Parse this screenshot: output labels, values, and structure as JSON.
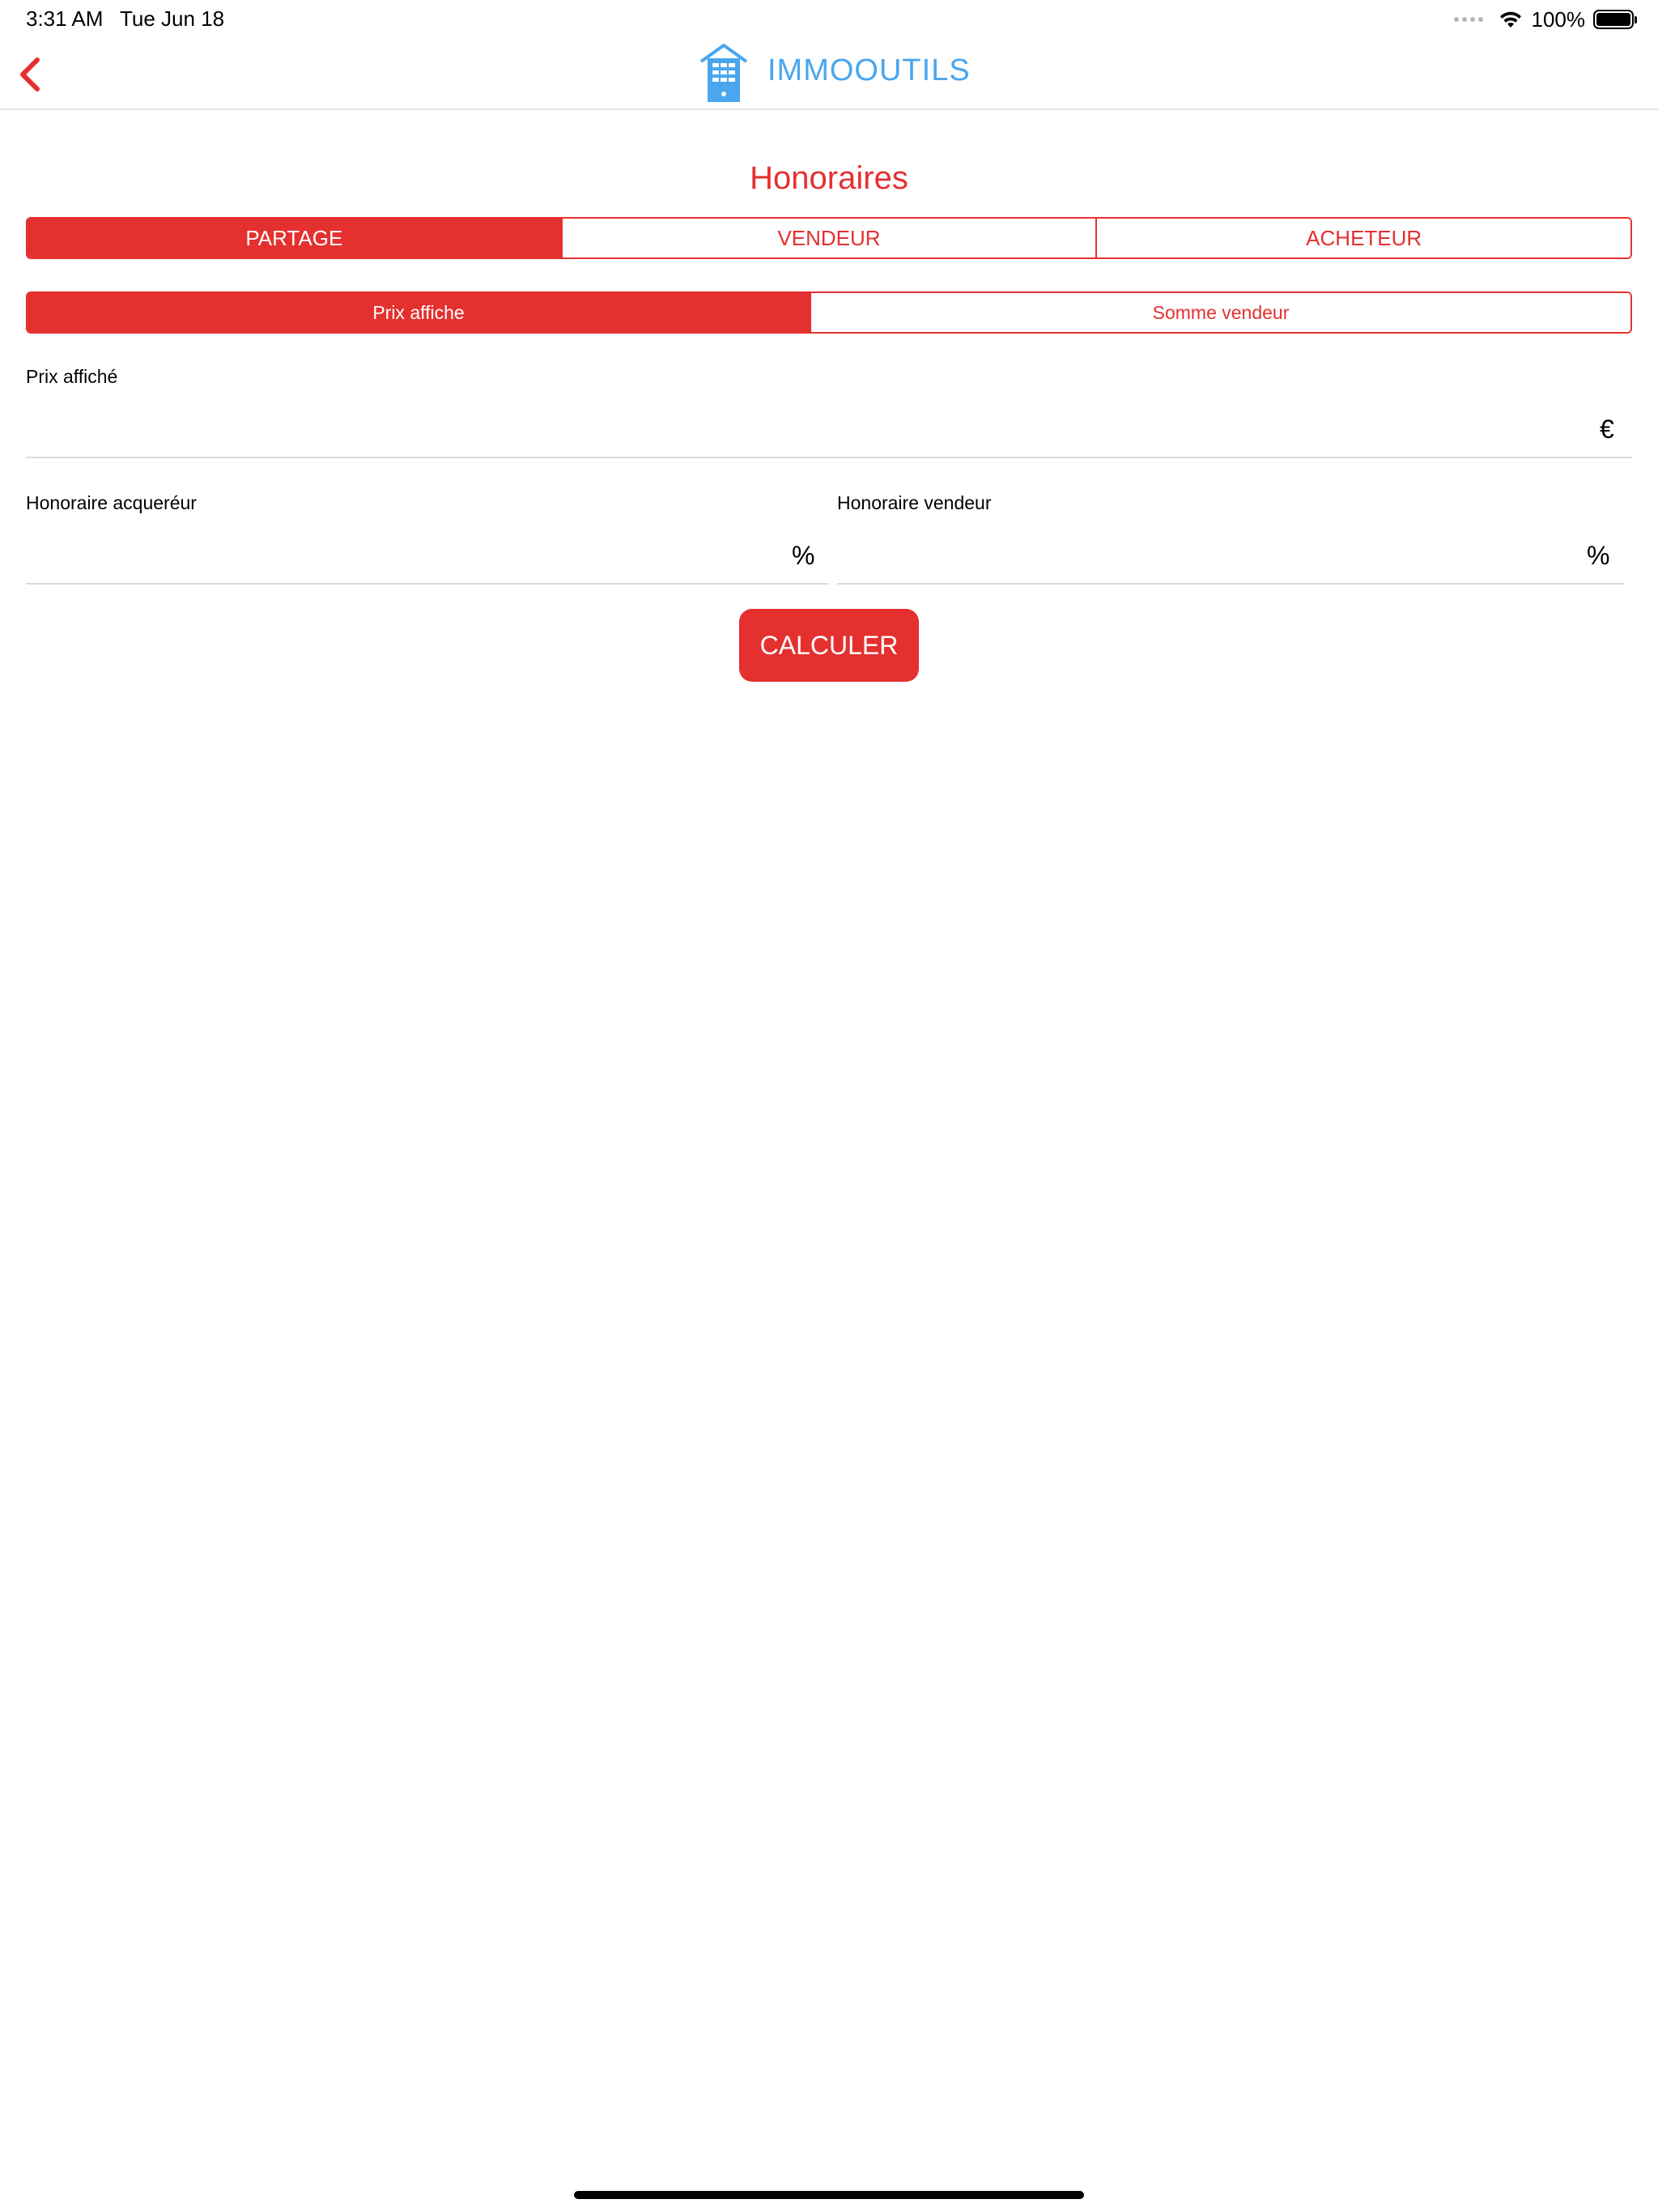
{
  "status_bar": {
    "time": "3:31 AM",
    "date": "Tue Jun 18",
    "battery": "100%"
  },
  "nav": {
    "brand": "IMMOOUTILS",
    "logo_icon": "building-house-icon",
    "back_icon": "chevron-left-icon"
  },
  "title": "Honoraires",
  "main_tabs": [
    {
      "label": "PARTAGE",
      "active": true
    },
    {
      "label": "VENDEUR",
      "active": false
    },
    {
      "label": "ACHETEUR",
      "active": false
    }
  ],
  "sub_tabs": [
    {
      "label": "Prix affiche",
      "active": true
    },
    {
      "label": "Somme vendeur",
      "active": false
    }
  ],
  "fields": {
    "prix_affiche": {
      "label": "Prix affiché",
      "value": "",
      "unit": "€"
    },
    "honoraire_acquereur": {
      "label": "Honoraire acqueréur",
      "value": "",
      "unit": "%"
    },
    "honoraire_vendeur": {
      "label": "Honoraire vendeur",
      "value": "",
      "unit": "%"
    }
  },
  "button": {
    "label": "CALCULER"
  },
  "colors": {
    "accent": "#e53030",
    "brand": "#4aa6ee"
  }
}
